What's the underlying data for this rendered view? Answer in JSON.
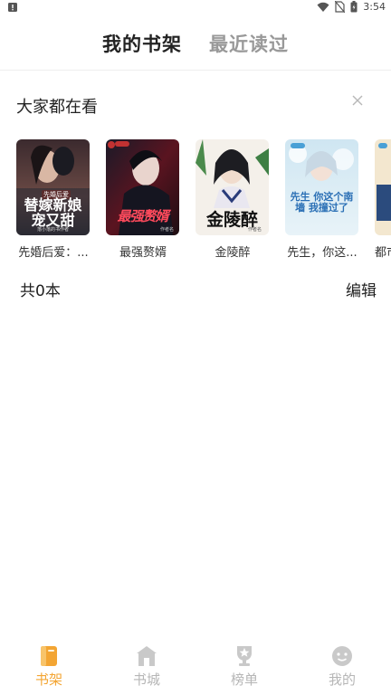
{
  "status_bar": {
    "time": "3:54"
  },
  "tabs": [
    {
      "label": "我的书架",
      "active": true
    },
    {
      "label": "最近读过",
      "active": false
    }
  ],
  "recommend": {
    "header": "大家都在看",
    "books": [
      {
        "title": "先婚后爱：...",
        "cover_title": "替嫁新娘宠又甜",
        "cover_tag": "先婚后爱",
        "cover_author": "落小落的书作者"
      },
      {
        "title": "最强赘婿",
        "cover_title": "最强赘婿",
        "cover_author": "作者名"
      },
      {
        "title": "金陵醉",
        "cover_title": "金陵醉",
        "cover_author": "作者名"
      },
      {
        "title": "先生，你这...",
        "cover_title": "先生 你这个南墙 我撞过了"
      },
      {
        "title": "都市..."
      }
    ]
  },
  "shelf": {
    "count_text": "共0本",
    "edit_label": "编辑"
  },
  "bottom_nav": [
    {
      "label": "书架",
      "active": true,
      "icon": "bookshelf-icon",
      "color": "#f3a533"
    },
    {
      "label": "书城",
      "active": false,
      "icon": "store-icon"
    },
    {
      "label": "榜单",
      "active": false,
      "icon": "ranking-icon"
    },
    {
      "label": "我的",
      "active": false,
      "icon": "profile-icon"
    }
  ]
}
